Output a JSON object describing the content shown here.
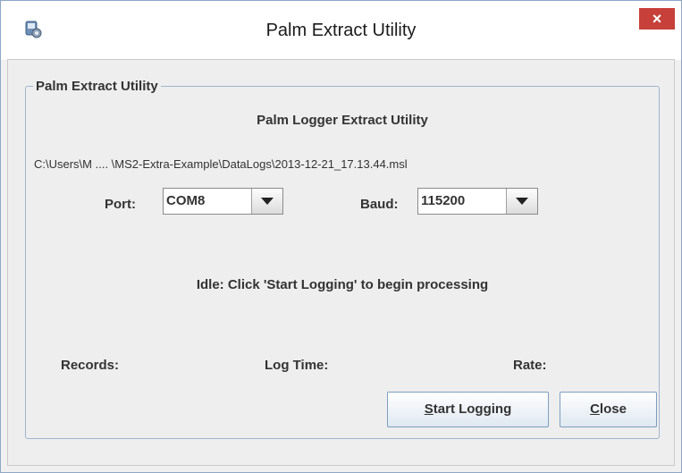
{
  "window": {
    "title": "Palm Extract Utility",
    "close_glyph": "×",
    "app_icon": "app-gear-icon"
  },
  "group": {
    "legend": "Palm Extract Utility",
    "heading": "Palm Logger Extract Utility",
    "file_path": "C:\\Users\\M .... \\MS2-Extra-Example\\DataLogs\\2013-12-21_17.13.44.msl"
  },
  "port": {
    "label": "Port:",
    "value": "COM8"
  },
  "baud": {
    "label": "Baud:",
    "value": "115200"
  },
  "status": "Idle: Click 'Start Logging' to begin processing",
  "stats": {
    "records_label": "Records:",
    "log_time_label": "Log Time:",
    "rate_label": "Rate:"
  },
  "buttons": {
    "start_mnemonic": "S",
    "start_rest": "tart Logging",
    "close_mnemonic": "C",
    "close_rest": "lose"
  },
  "colors": {
    "close_button": "#c7403a",
    "group_border": "#9fb4cc",
    "button_border": "#7d9ec0"
  }
}
